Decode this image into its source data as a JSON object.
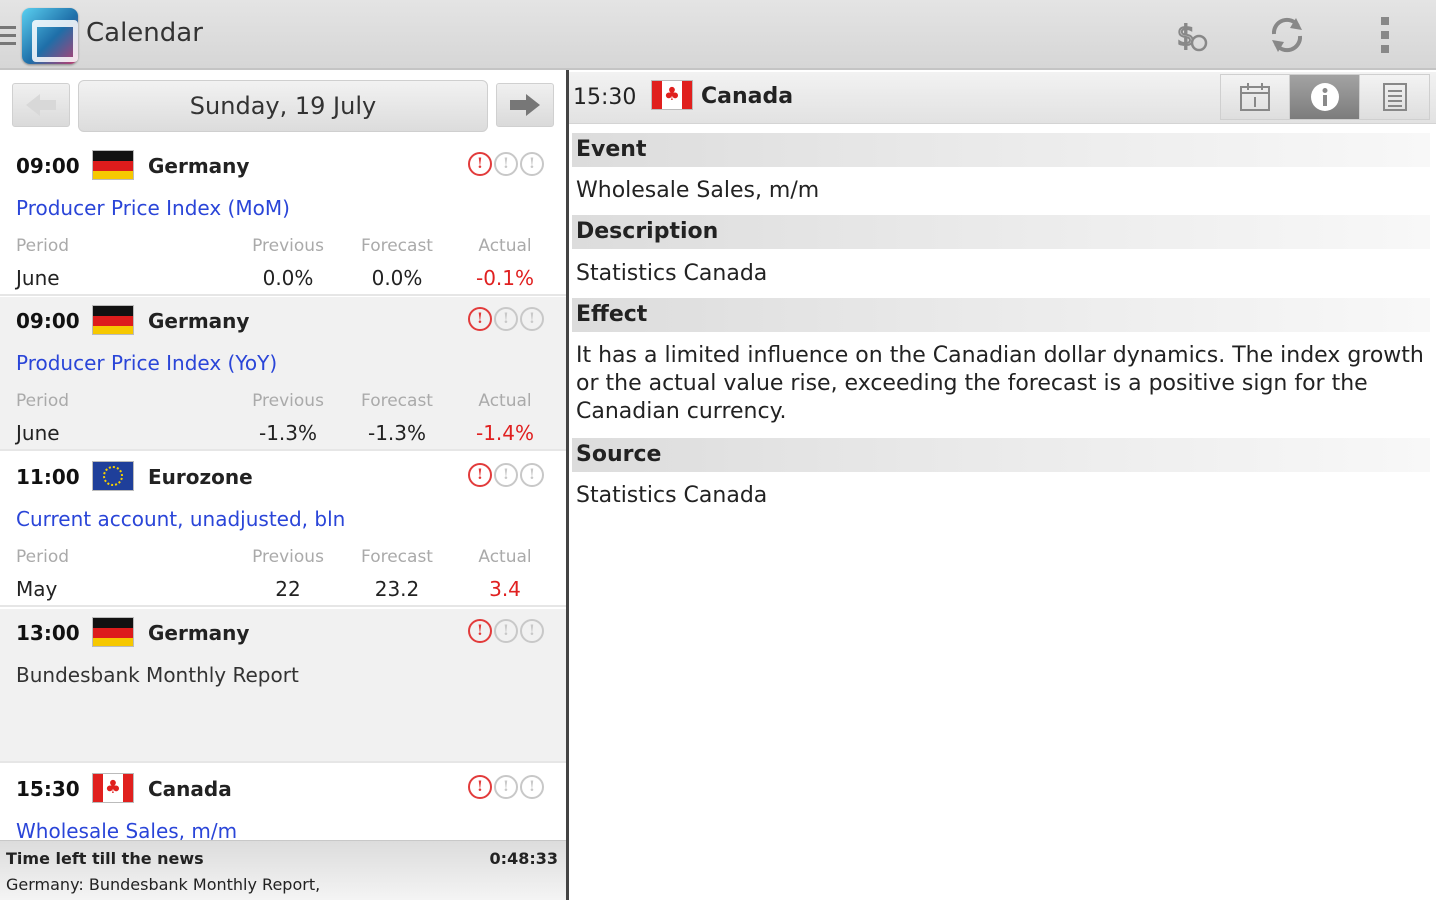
{
  "app": {
    "title": "Calendar"
  },
  "toolbar": {
    "icons": [
      "currency-filter-icon",
      "refresh-icon",
      "overflow-menu-icon"
    ]
  },
  "datebar": {
    "date": "Sunday, 19 July"
  },
  "labels": {
    "period": "Period",
    "previous": "Previous",
    "forecast": "Forecast",
    "actual": "Actual"
  },
  "events": [
    {
      "time": "09:00",
      "country": "Germany",
      "name": "Producer Price Index (MoM)",
      "period": "June",
      "previous": "0.0%",
      "forecast": "0.0%",
      "actual": "-0.1%",
      "importance": 1
    },
    {
      "time": "09:00",
      "country": "Germany",
      "name": "Producer Price Index (YoY)",
      "period": "June",
      "previous": "-1.3%",
      "forecast": "-1.3%",
      "actual": "-1.4%",
      "importance": 1
    },
    {
      "time": "11:00",
      "country": "Eurozone",
      "name": "Current account, unadjusted, bln",
      "period": "May",
      "previous": "22",
      "forecast": "23.2",
      "actual": "3.4",
      "importance": 1
    },
    {
      "time": "13:00",
      "country": "Germany",
      "name": "Bundesbank Monthly Report",
      "importance": 1
    },
    {
      "time": "15:30",
      "country": "Canada",
      "name": "Wholesale Sales, m/m",
      "importance": 1
    }
  ],
  "footer": {
    "label": "Time left till the news",
    "countdown": "0:48:33",
    "next": "Germany: Bundesbank Monthly Report,"
  },
  "detail": {
    "time": "15:30",
    "country": "Canada",
    "event_heading": "Event",
    "event": "Wholesale Sales, m/m",
    "description_heading": "Description",
    "description": "Statistics Canada",
    "effect_heading": "Effect",
    "effect": "It has a limited influence on the Canadian dollar dynamics. The index growth or the actual value rise, exceeding the forecast is a positive sign for the Canadian currency.",
    "source_heading": "Source",
    "source": "Statistics Canada"
  },
  "colors": {
    "link": "#2a45d8",
    "negative": "#e02020",
    "importance_on": "#e23b3b"
  }
}
